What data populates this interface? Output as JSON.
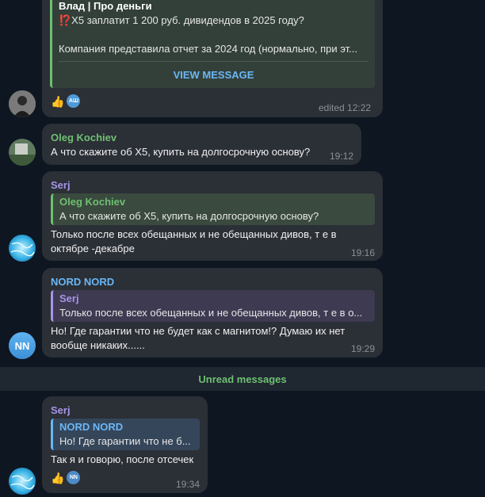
{
  "messages": {
    "m1": {
      "quote_author": "Влад | Про деньги",
      "quote_line1": "⁉️X5 заплатит 1 200 руб. дивидендов в 2025 году?",
      "quote_line2": "Компания представила отчет за 2024 год (нормально, при эт...",
      "view_label": "VIEW MESSAGE",
      "time": "edited 12:22",
      "react_initials": "АШ",
      "react_emoji": "👍"
    },
    "m2": {
      "author": "Oleg Kochiev",
      "text": "А что скажите об X5, купить на долгосрочную основу?",
      "time": "19:12"
    },
    "m3": {
      "author": "Serj",
      "quote_author": "Oleg Kochiev",
      "quote_text": "А что скажите об X5, купить на долгосрочную основу?",
      "text_line1": "Только после всех обещанных и не обещанных дивов, т е в",
      "text_line2": "октябре -декабре",
      "time": "19:16"
    },
    "m4": {
      "author": "NORD NORD",
      "quote_author": "Serj",
      "quote_text": "Только после всех обещанных и не обещанных дивов, т е в о...",
      "text_line1": "Но! Где гарантии что не будет как с магнитом!? Думаю их нет",
      "text_line2": "вообще никаких......",
      "time": "19:29",
      "avatar_initials": "NN"
    },
    "divider": "Unread messages",
    "m5": {
      "author": "Serj",
      "quote_author": "NORD NORD",
      "quote_text": "Но! Где гарантии что не б...",
      "text": "Так я и говорю, после отсечек",
      "time": "19:34",
      "react_initials": "NN",
      "react_emoji": "👍"
    }
  },
  "colors": {
    "green": "#6fbf73",
    "purple": "#a695e7",
    "blue": "#6ab7f5",
    "bubble": "#2b2f36",
    "background": "#0e1621"
  }
}
